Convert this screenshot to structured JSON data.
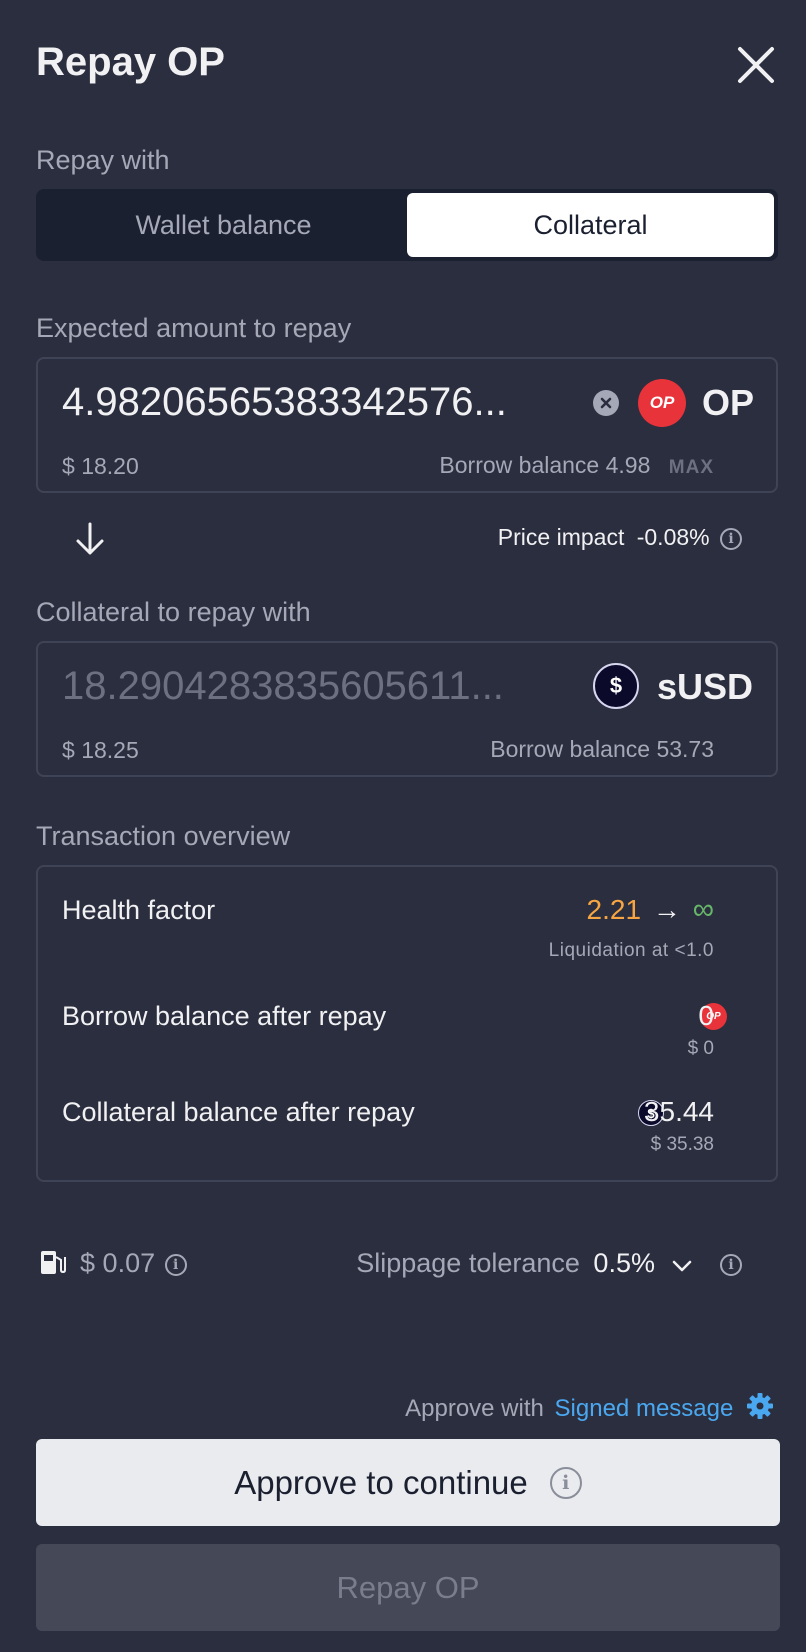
{
  "header": {
    "title": "Repay OP"
  },
  "repay_with": {
    "label": "Repay with",
    "options": [
      "Wallet balance",
      "Collateral"
    ],
    "selected": "Collateral"
  },
  "expected": {
    "label": "Expected amount to repay",
    "amount": "4.98206565383342576...",
    "token": "OP",
    "logo_text": "OP",
    "usd_symbol": "$",
    "usd": "18.20",
    "balance_label": "Borrow balance",
    "balance": "4.98",
    "max": "MAX"
  },
  "price_impact": {
    "label": "Price impact",
    "value": "-0.08%"
  },
  "collateral": {
    "label": "Collateral to repay with",
    "amount": "18.2904283835605611...",
    "token": "sUSD",
    "logo_text": "$",
    "usd_symbol": "$",
    "usd": "18.25",
    "balance_label": "Borrow balance",
    "balance": "53.73"
  },
  "overview": {
    "label": "Transaction overview",
    "health_factor": {
      "label": "Health factor",
      "from": "2.21",
      "arrow": "→",
      "to": "∞",
      "liquidation": "Liquidation at <1.0"
    },
    "borrow_after": {
      "label": "Borrow balance after repay",
      "value": "0",
      "usd": "$ 0",
      "logo_text": "OP"
    },
    "collateral_after": {
      "label": "Collateral balance after repay",
      "value": "35.44",
      "usd": "$ 35.38",
      "logo_text": "$"
    }
  },
  "gas": {
    "symbol": "$",
    "value": "0.07"
  },
  "slippage": {
    "label": "Slippage tolerance",
    "value": "0.5%"
  },
  "approve_with": {
    "label": "Approve with",
    "method": "Signed message"
  },
  "buttons": {
    "approve": "Approve to continue",
    "repay": "Repay OP"
  },
  "colors": {
    "background": "#2b2e3e",
    "health_from": "#f7a542",
    "health_to": "#66b66a",
    "link": "#4aa8f0",
    "op_red": "#e8333a"
  }
}
